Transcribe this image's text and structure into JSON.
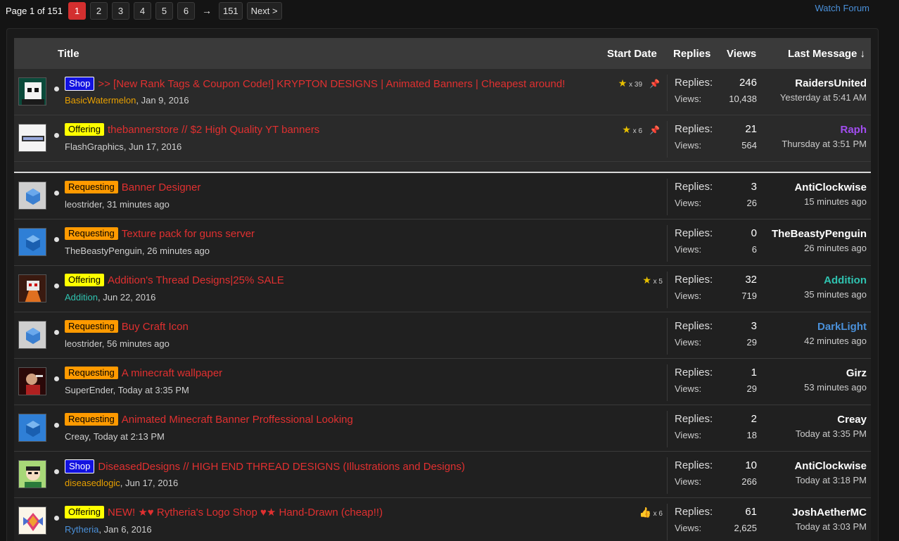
{
  "pagination": {
    "label": "Page 1 of 151",
    "pages": [
      "1",
      "2",
      "3",
      "4",
      "5",
      "6"
    ],
    "arrow": "→",
    "last_page": "151",
    "next": "Next >"
  },
  "watch_forum": "Watch Forum",
  "headers": {
    "title": "Title",
    "start_date": "Start Date",
    "replies": "Replies",
    "views": "Views",
    "last_message": "Last Message ↓"
  },
  "labels": {
    "replies": "Replies:",
    "views": "Views:"
  },
  "threads": [
    {
      "prefix": "Shop",
      "title": ">> [New Rank Tags & Coupon Code!] KRYPTON DESIGNS | Animated Banners | Cheapest around!",
      "author": "BasicWatermelon",
      "date": ", Jan 9, 2016",
      "badge": "x 39",
      "badge_icon": "★",
      "pinned": "📌",
      "replies": "246",
      "views": "10,438",
      "last_user": "RaidersUnited",
      "last_time": "Yesterday at 5:41 AM"
    },
    {
      "prefix": "Offering",
      "title": "thebannerstore // $2 High Quality YT banners",
      "author": "FlashGraphics",
      "date": ", Jun 17, 2016",
      "badge": "x 6",
      "badge_icon": "★",
      "pinned": "📌",
      "replies": "21",
      "views": "564",
      "last_user": "Raph",
      "last_time": "Thursday at 3:51 PM"
    },
    {
      "prefix": "Requesting",
      "title": "Banner Designer",
      "author": "leostrider",
      "date": ", 31 minutes ago",
      "replies": "3",
      "views": "26",
      "last_user": "AntiClockwise",
      "last_time": "15 minutes ago"
    },
    {
      "prefix": "Requesting",
      "title": "Texture pack for guns server",
      "author": "TheBeastyPenguin",
      "date": ", 26 minutes ago",
      "replies": "0",
      "views": "6",
      "last_user": "TheBeastyPenguin",
      "last_time": "26 minutes ago"
    },
    {
      "prefix": "Offering",
      "title": "Addition's Thread Designs|25% SALE",
      "author": "Addition",
      "date": ", Jun 22, 2016",
      "badge": "x 5",
      "badge_icon": "★",
      "replies": "32",
      "views": "719",
      "last_user": "Addition",
      "last_time": "35 minutes ago"
    },
    {
      "prefix": "Requesting",
      "title": "Buy Craft Icon",
      "author": "leostrider",
      "date": ", 56 minutes ago",
      "replies": "3",
      "views": "29",
      "last_user": "DarkLight",
      "last_time": "42 minutes ago"
    },
    {
      "prefix": "Requesting",
      "title": "A minecraft wallpaper",
      "author": "SuperEnder",
      "date": ", Today at 3:35 PM",
      "replies": "1",
      "views": "29",
      "last_user": "Girz",
      "last_time": "53 minutes ago"
    },
    {
      "prefix": "Requesting",
      "title": "Animated Minecraft Banner Proffessional Looking",
      "author": "Creay",
      "date": ", Today at 2:13 PM",
      "replies": "2",
      "views": "18",
      "last_user": "Creay",
      "last_time": "Today at 3:35 PM"
    },
    {
      "prefix": "Shop",
      "title": "DiseasedDesigns // HIGH END THREAD DESIGNS (Illustrations and Designs)",
      "author": "diseasedlogic",
      "date": ", Jun 17, 2016",
      "replies": "10",
      "views": "266",
      "last_user": "AntiClockwise",
      "last_time": "Today at 3:18 PM"
    },
    {
      "prefix": "Offering",
      "title": "NEW! ★♥ Rytheria's Logo Shop ♥★ Hand-Drawn (cheap!!)",
      "author": "Rytheria",
      "date": ", Jan 6, 2016",
      "badge": "x 6",
      "badge_icon": "👍",
      "replies": "61",
      "views": "2,625",
      "last_user": "JoshAetherMC",
      "last_time": "Today at 3:03 PM"
    }
  ],
  "colors": {
    "accent_red": "#e03030",
    "current_page": "#d32f2f",
    "link_blue": "#4a90d9",
    "prefix_shop": "#1212e0",
    "prefix_offering": "#ffff00",
    "prefix_requesting": "#ff9a00"
  }
}
